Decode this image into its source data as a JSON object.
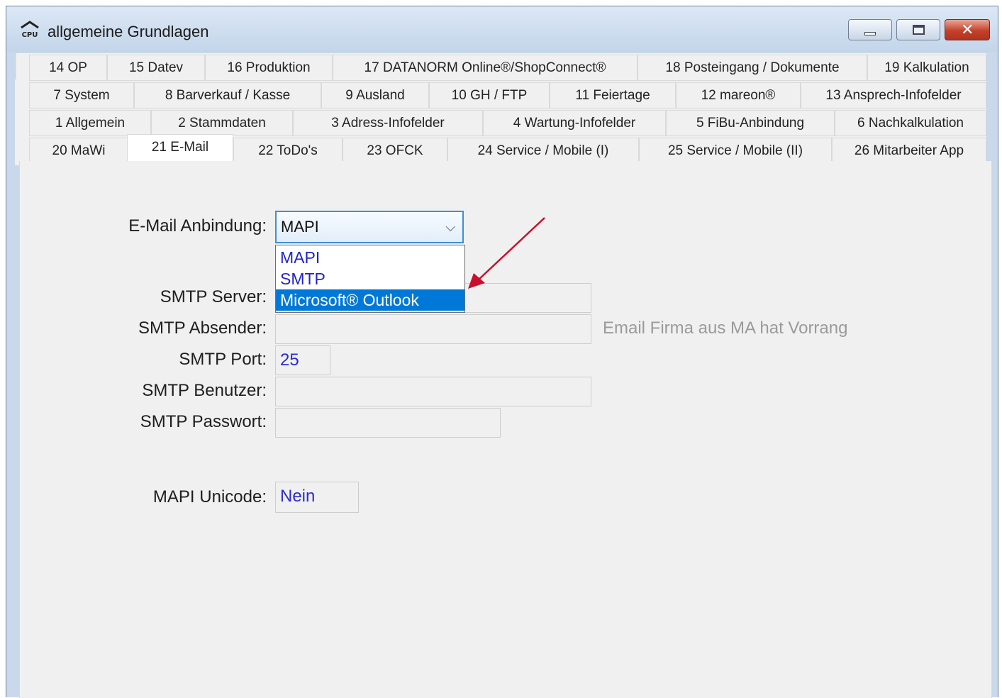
{
  "window": {
    "title": "allgemeine Grundlagen",
    "icon_text": "CPU"
  },
  "tabs": {
    "row1": [
      "14 OP",
      "15 Datev",
      "16 Produktion",
      "17 DATANORM Online®/ShopConnect®",
      "18 Posteingang / Dokumente",
      "19 Kalkulation"
    ],
    "row2": [
      "7 System",
      "8 Barverkauf / Kasse",
      "9 Ausland",
      "10 GH / FTP",
      "11 Feiertage",
      "12 mareon®",
      "13 Ansprech-Infofelder"
    ],
    "row3": [
      "1 Allgemein",
      "2 Stammdaten",
      "3 Adress-Infofelder",
      "4 Wartung-Infofelder",
      "5 FiBu-Anbindung",
      "6 Nachkalkulation"
    ],
    "row4": [
      "20 MaWi",
      "21 E-Mail",
      "22 ToDo's",
      "23 OFCK",
      "24 Service / Mobile (I)",
      "25 Service / Mobile (II)",
      "26 Mitarbeiter App"
    ],
    "active": "21 E-Mail"
  },
  "form": {
    "email_label": "E-Mail Anbindung:",
    "email_value": "MAPI",
    "email_options": [
      "MAPI",
      "SMTP",
      "Microsoft® Outlook"
    ],
    "email_highlighted": "Microsoft® Outlook",
    "smtp_server_label": "SMTP Server:",
    "smtp_server_value": "",
    "smtp_sender_label": "SMTP Absender:",
    "smtp_sender_value": "",
    "smtp_sender_hint": "Email Firma aus MA hat Vorrang",
    "smtp_port_label": "SMTP Port:",
    "smtp_port_value": "25",
    "smtp_user_label": "SMTP Benutzer:",
    "smtp_user_value": "",
    "smtp_pass_label": "SMTP Passwort:",
    "smtp_pass_value": "",
    "mapi_unicode_label": "MAPI Unicode:",
    "mapi_unicode_value": "Nein"
  },
  "colors": {
    "selection": "#0078d7",
    "value_text": "#2323c8",
    "annotation_arrow": "#c8102e"
  }
}
